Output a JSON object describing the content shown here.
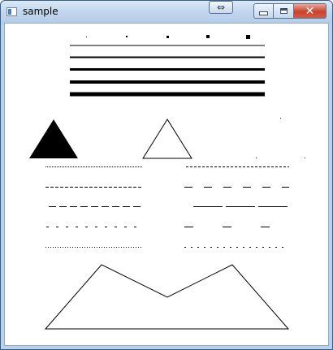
{
  "window": {
    "title": "sample",
    "icons": {
      "app": "app-window-icon",
      "resize": "resize-arrows-icon",
      "minimize": "minimize-icon",
      "maximize": "maximize-icon",
      "close": "close-icon"
    },
    "resize_glyph": "⇔",
    "close_glyph": "✕"
  },
  "colors": {
    "titlebar": "#c2d7ee",
    "close_button": "#c9442d",
    "ink": "#000000",
    "canvas": "#ffffff"
  }
}
